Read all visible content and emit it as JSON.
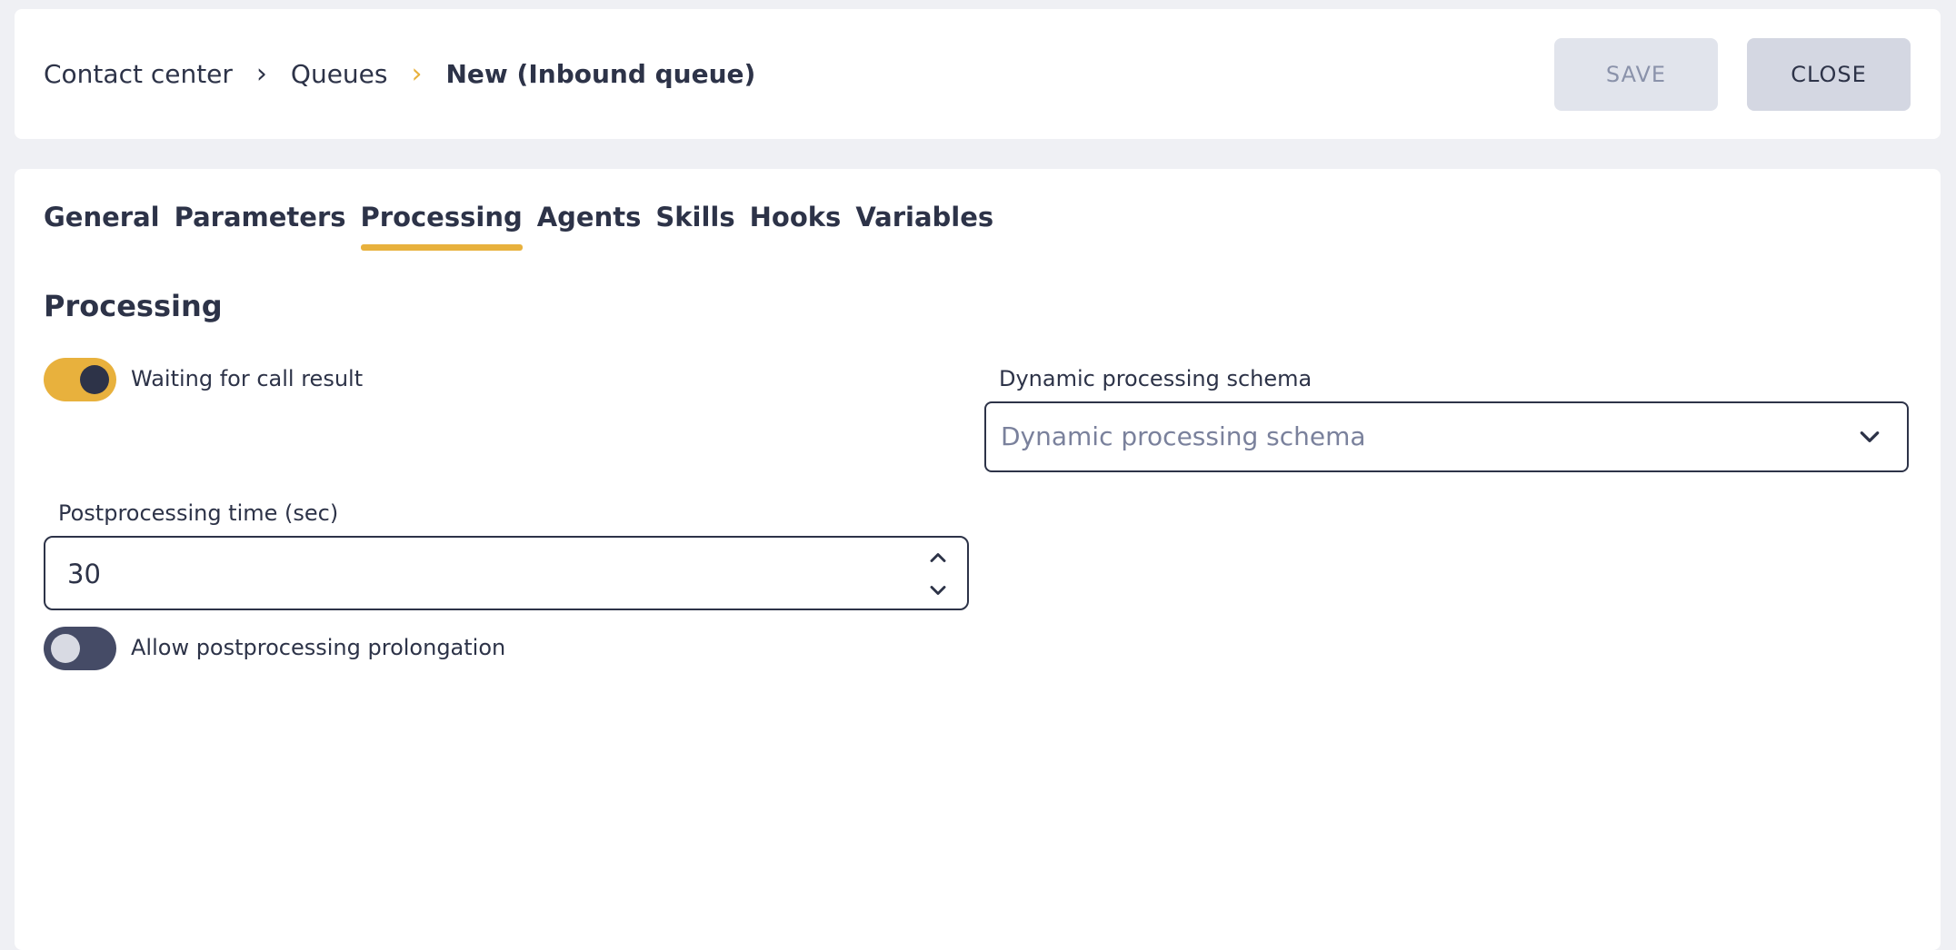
{
  "header": {
    "breadcrumb": [
      "Contact center",
      "Queues",
      "New (Inbound queue)"
    ],
    "separator": "›",
    "save_label": "SAVE",
    "close_label": "CLOSE"
  },
  "tabs": [
    "General",
    "Parameters",
    "Processing",
    "Agents",
    "Skills",
    "Hooks",
    "Variables"
  ],
  "active_tab": "Processing",
  "section": {
    "title": "Processing",
    "waiting_toggle": {
      "label": "Waiting for call result",
      "on": true
    },
    "schema": {
      "label": "Dynamic processing schema",
      "placeholder": "Dynamic processing schema"
    },
    "postprocessing": {
      "label": "Postprocessing time (sec)",
      "value": "30"
    },
    "prolongation_toggle": {
      "label": "Allow postprocessing prolongation",
      "on": false
    }
  },
  "colors": {
    "accent": "#e8b13d",
    "text": "#2d3348",
    "toggle_off": "#454b66"
  },
  "icons": {
    "separator": "chevron-right-icon",
    "select": "chevron-down-icon",
    "spin_up": "chevron-up-icon",
    "spin_down": "chevron-down-icon"
  }
}
